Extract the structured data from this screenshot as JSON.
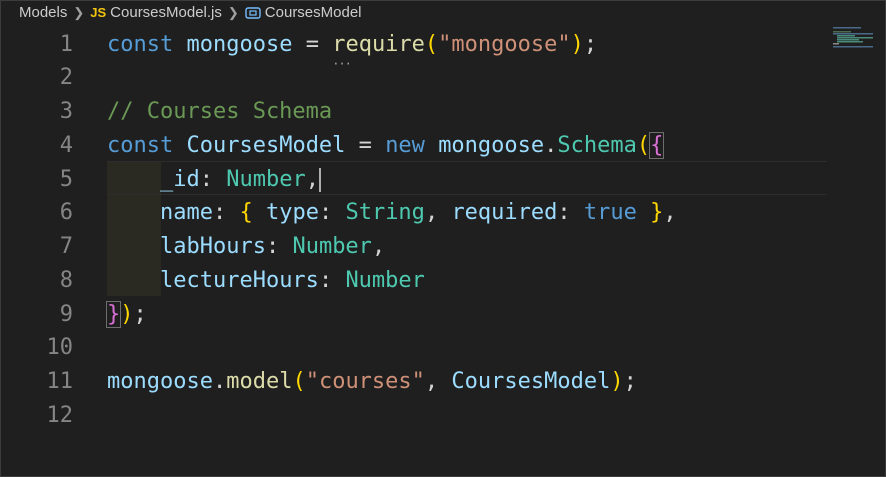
{
  "breadcrumb": {
    "folder": "Models",
    "file_badge": "JS",
    "file": "CoursesModel.js",
    "symbol": "CoursesModel"
  },
  "editor": {
    "line_numbers": [
      "1",
      "2",
      "3",
      "4",
      "5",
      "6",
      "7",
      "8",
      "9",
      "10",
      "11",
      "12"
    ],
    "lines": [
      [
        {
          "t": "const",
          "c": "kw"
        },
        {
          "t": " "
        },
        {
          "t": "mongoose",
          "c": "var"
        },
        {
          "t": " = "
        },
        {
          "t": "require",
          "c": "fn squiggle"
        },
        {
          "t": "(",
          "c": "br1"
        },
        {
          "t": "\"mongoose\"",
          "c": "str"
        },
        {
          "t": ")",
          "c": "br1"
        },
        {
          "t": ";"
        }
      ],
      [],
      [
        {
          "t": "// Courses Schema",
          "c": "cm"
        }
      ],
      [
        {
          "t": "const",
          "c": "kw"
        },
        {
          "t": " "
        },
        {
          "t": "CoursesModel",
          "c": "var"
        },
        {
          "t": " = "
        },
        {
          "t": "new",
          "c": "kw"
        },
        {
          "t": " "
        },
        {
          "t": "mongoose",
          "c": "var"
        },
        {
          "t": "."
        },
        {
          "t": "Schema",
          "c": "type"
        },
        {
          "t": "(",
          "c": "br1"
        },
        {
          "t": "{",
          "c": "br2 bm"
        }
      ],
      [
        {
          "t": "    "
        },
        {
          "t": "_id",
          "c": "var"
        },
        {
          "t": ": "
        },
        {
          "t": "Number",
          "c": "type"
        },
        {
          "t": ","
        },
        {
          "cursor": true
        }
      ],
      [
        {
          "t": "    "
        },
        {
          "t": "name",
          "c": "var"
        },
        {
          "t": ": "
        },
        {
          "t": "{",
          "c": "br1"
        },
        {
          "t": " "
        },
        {
          "t": "type",
          "c": "var"
        },
        {
          "t": ": "
        },
        {
          "t": "String",
          "c": "type"
        },
        {
          "t": ", "
        },
        {
          "t": "required",
          "c": "var"
        },
        {
          "t": ": "
        },
        {
          "t": "true",
          "c": "kw"
        },
        {
          "t": " "
        },
        {
          "t": "}",
          "c": "br1"
        },
        {
          "t": ","
        }
      ],
      [
        {
          "t": "    "
        },
        {
          "t": "labHours",
          "c": "var"
        },
        {
          "t": ": "
        },
        {
          "t": "Number",
          "c": "type"
        },
        {
          "t": ","
        }
      ],
      [
        {
          "t": "    "
        },
        {
          "t": "lectureHours",
          "c": "var"
        },
        {
          "t": ": "
        },
        {
          "t": "Number",
          "c": "type"
        }
      ],
      [
        {
          "t": "}",
          "c": "br2 bm"
        },
        {
          "t": ")",
          "c": "br1"
        },
        {
          "t": ";"
        }
      ],
      [],
      [
        {
          "t": "mongoose",
          "c": "var"
        },
        {
          "t": "."
        },
        {
          "t": "model",
          "c": "fn"
        },
        {
          "t": "(",
          "c": "br1"
        },
        {
          "t": "\"courses\"",
          "c": "str"
        },
        {
          "t": ", "
        },
        {
          "t": "CoursesModel",
          "c": "var"
        },
        {
          "t": ")",
          "c": "br1"
        },
        {
          "t": ";"
        }
      ],
      []
    ]
  },
  "colors": {
    "background": "#1f1f1f",
    "keyword": "#569cd6",
    "variable": "#9cdcfe",
    "function": "#dcdcaa",
    "string": "#ce9178",
    "type": "#4ec9b0",
    "comment": "#6a9955"
  }
}
